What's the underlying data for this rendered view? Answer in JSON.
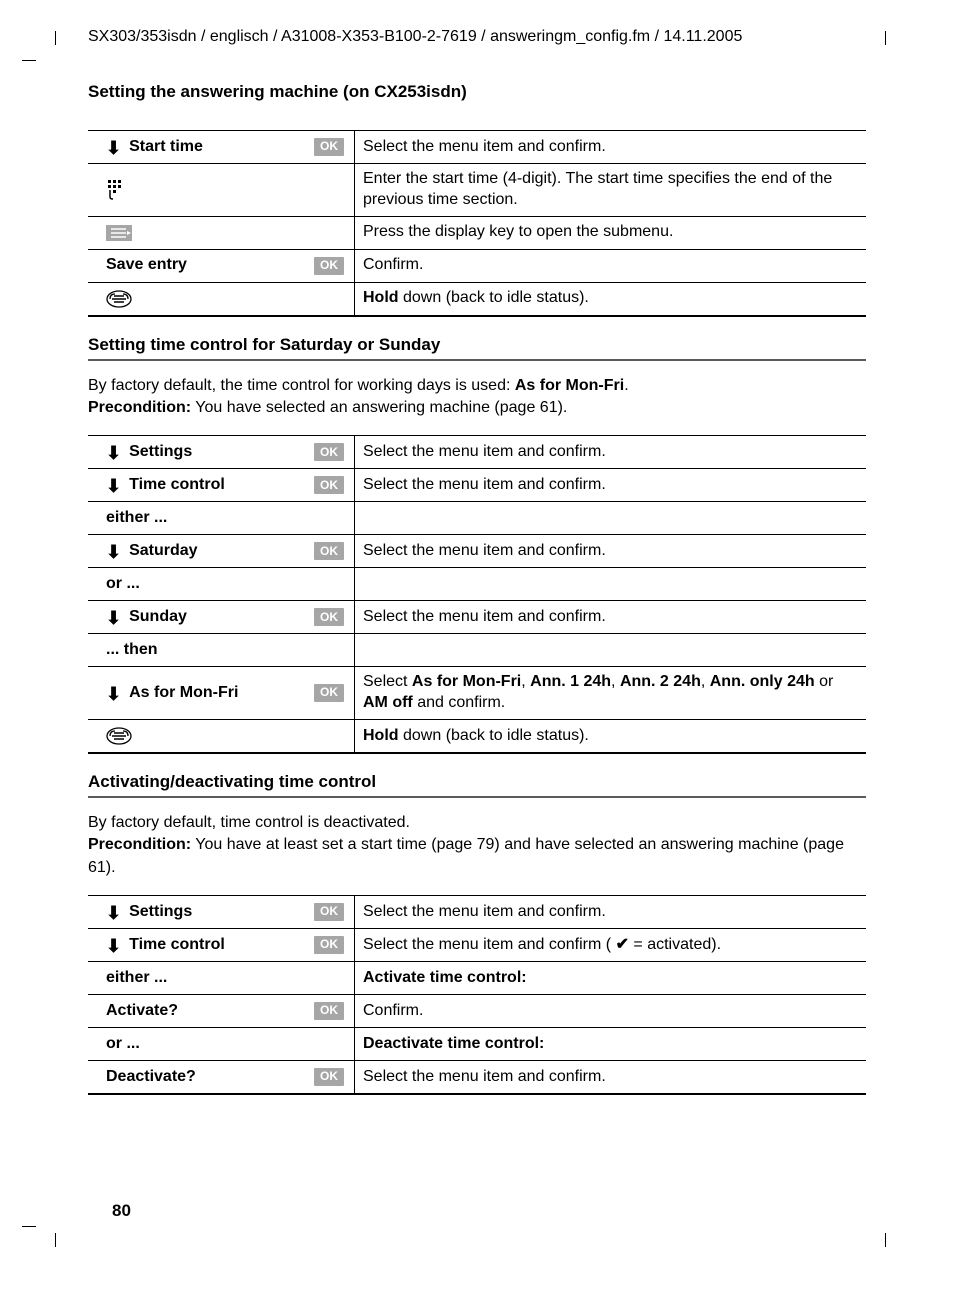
{
  "header": "SX303/353isdn / englisch / A31008-X353-B100-2-7619 / answeringm_config.fm / 14.11.2005",
  "section_title": "Setting the answering machine (on CX253isdn)",
  "page_number": "80",
  "ok_label": "OK",
  "table1": {
    "rows": [
      {
        "icon": "arrow",
        "label": "Start time",
        "ok": true,
        "desc": "Select the menu item and confirm."
      },
      {
        "icon": "keypad",
        "label": "",
        "ok": false,
        "desc": "Enter the start time (4-digit). The start time specifies the end of the previous time section."
      },
      {
        "icon": "list",
        "label": "",
        "ok": false,
        "desc": "Press the display key to open the submenu."
      },
      {
        "icon": "",
        "label": "Save entry",
        "ok": true,
        "desc": "Confirm."
      },
      {
        "icon": "hangup",
        "label": "",
        "ok": false,
        "desc_prefix_bold": "Hold",
        "desc_rest": " down (back to idle status)."
      }
    ]
  },
  "sub2": {
    "title": "Setting time control for Saturday or Sunday",
    "para1_pre": "By factory default, the time control for working days is used: ",
    "para1_bold": "As for Mon-Fri",
    "para1_post": ".",
    "para2_bold": "Precondition:",
    "para2_rest": " You have selected an answering machine (page 61)."
  },
  "table2": {
    "rows": [
      {
        "icon": "arrow",
        "label": "Settings",
        "ok": true,
        "desc": "Select the menu item and confirm."
      },
      {
        "icon": "arrow",
        "label": "Time control",
        "ok": true,
        "desc": "Select the menu item and confirm."
      },
      {
        "icon": "",
        "label": "either ...",
        "ok": false,
        "desc": ""
      },
      {
        "icon": "arrow",
        "label": "Saturday",
        "ok": true,
        "desc": "Select the menu item and confirm."
      },
      {
        "icon": "",
        "label": "or ...",
        "ok": false,
        "desc": ""
      },
      {
        "icon": "arrow",
        "label": "Sunday",
        "ok": true,
        "desc": "Select the menu item and confirm."
      },
      {
        "icon": "",
        "label": "... then",
        "ok": false,
        "desc": ""
      },
      {
        "icon": "arrow",
        "label": "As for Mon-Fri",
        "ok": true,
        "desc_parts": [
          "Select ",
          "As for Mon-Fri",
          ", ",
          "Ann. 1  24h",
          ", ",
          "Ann. 2  24h",
          ", ",
          "Ann. only 24h",
          " or ",
          "AM off",
          " and confirm."
        ]
      },
      {
        "icon": "hangup",
        "label": "",
        "ok": false,
        "desc_prefix_bold": "Hold",
        "desc_rest": " down (back to idle status)."
      }
    ]
  },
  "sub3": {
    "title": "Activating/deactivating time control",
    "para1": "By factory default, time control is deactivated.",
    "para2_bold": "Precondition:",
    "para2_rest": " You have at least set a start time (page 79) and have selected an answering machine (page 61)."
  },
  "table3": {
    "rows": [
      {
        "icon": "arrow",
        "label": "Settings",
        "ok": true,
        "desc": "Select the menu item and confirm."
      },
      {
        "icon": "arrow",
        "label": "Time control",
        "ok": true,
        "desc_pre": "Select the menu item and confirm ( ",
        "desc_check": "✔",
        "desc_post": " = activated)."
      },
      {
        "icon": "",
        "label": "either ...",
        "ok": false,
        "desc_bold": "Activate time control:"
      },
      {
        "icon": "",
        "label": "Activate?",
        "ok": true,
        "desc": "Confirm."
      },
      {
        "icon": "",
        "label": "or ...",
        "ok": false,
        "desc_bold": "Deactivate time control:"
      },
      {
        "icon": "",
        "label": "Deactivate?",
        "ok": true,
        "desc": "Select the menu item and confirm."
      }
    ]
  }
}
